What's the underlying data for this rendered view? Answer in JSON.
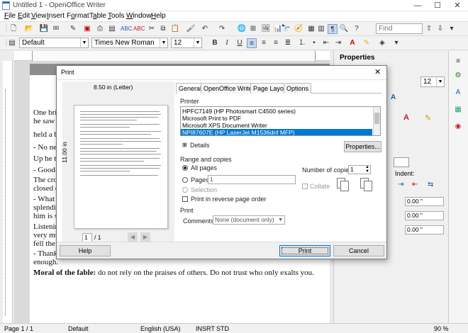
{
  "window": {
    "title": "Untitled 1 - OpenOffice Writer",
    "min": "—",
    "max": "☐",
    "close": "✕"
  },
  "menu": [
    {
      "l": "File",
      "k": "F"
    },
    {
      "l": "Edit",
      "k": "E"
    },
    {
      "l": "View",
      "k": "V"
    },
    {
      "l": "Insert",
      "k": "I"
    },
    {
      "l": "Format",
      "k": "o"
    },
    {
      "l": "Table",
      "k": "a"
    },
    {
      "l": "Tools",
      "k": "T"
    },
    {
      "l": "Window",
      "k": "W"
    },
    {
      "l": "Help",
      "k": "H"
    }
  ],
  "toolbar": {
    "find_placeholder": "Find"
  },
  "formatting": {
    "paragraph_style": "Default",
    "font_name": "Times New Roman",
    "font_size": "12",
    "bold": "B",
    "italic": "I",
    "underline": "U"
  },
  "document": {
    "lines": [
      "One brig",
      "he saw a",
      "held a bi",
      "- No nee",
      "Up he t",
      "- Good-s",
      "The crov",
      "closed o",
      "- What a",
      "splendid",
      "him is s",
      "Listening",
      "very mu",
      "fell the c",
      "- Thank",
      "enough."
    ],
    "moral_bold": "Moral of the fable:",
    "moral_text": " do not rely on the praises of others. Do not trust who only exalts you."
  },
  "sidebar": {
    "title": "Properties",
    "font_size": "12",
    "indent_label": "Indent:",
    "spacing_value": "0.00 \"",
    "line_value": "0.00 \""
  },
  "status": {
    "page": "Page 1 / 1",
    "style": "Default",
    "language": "English (USA)",
    "mode": "INSRT",
    "selection": "STD",
    "zoom": "90 %"
  },
  "dialog": {
    "title": "Print",
    "preview_size": "8.50 in (Letter)",
    "preview_height": "11.00 in",
    "page_input": "1",
    "page_total": "/ 1",
    "tabs": [
      "General",
      "OpenOffice Writer",
      "Page Layout",
      "Options"
    ],
    "printer_label": "Printer",
    "printers": [
      "HPFC7149 (HP Photosmart C4500 series)",
      "Microsoft Print to PDF",
      "Microsoft XPS Document Writer",
      "NPI87607E (HP LaserJet M1536dnf MFP)"
    ],
    "selected_printer": 3,
    "details": "Details",
    "properties": "Properties...",
    "range_label": "Range and copies",
    "all_pages": "All pages",
    "pages": "Pages",
    "pages_value": "1",
    "selection": "Selection",
    "reverse": "Print in reverse page order",
    "copies_label": "Number of copies",
    "copies_value": "1",
    "collate": "Collate",
    "print_section": "Print",
    "comments_label": "Comments",
    "comments_value": "None (document only)",
    "help": "Help",
    "print": "Print",
    "cancel": "Cancel"
  }
}
